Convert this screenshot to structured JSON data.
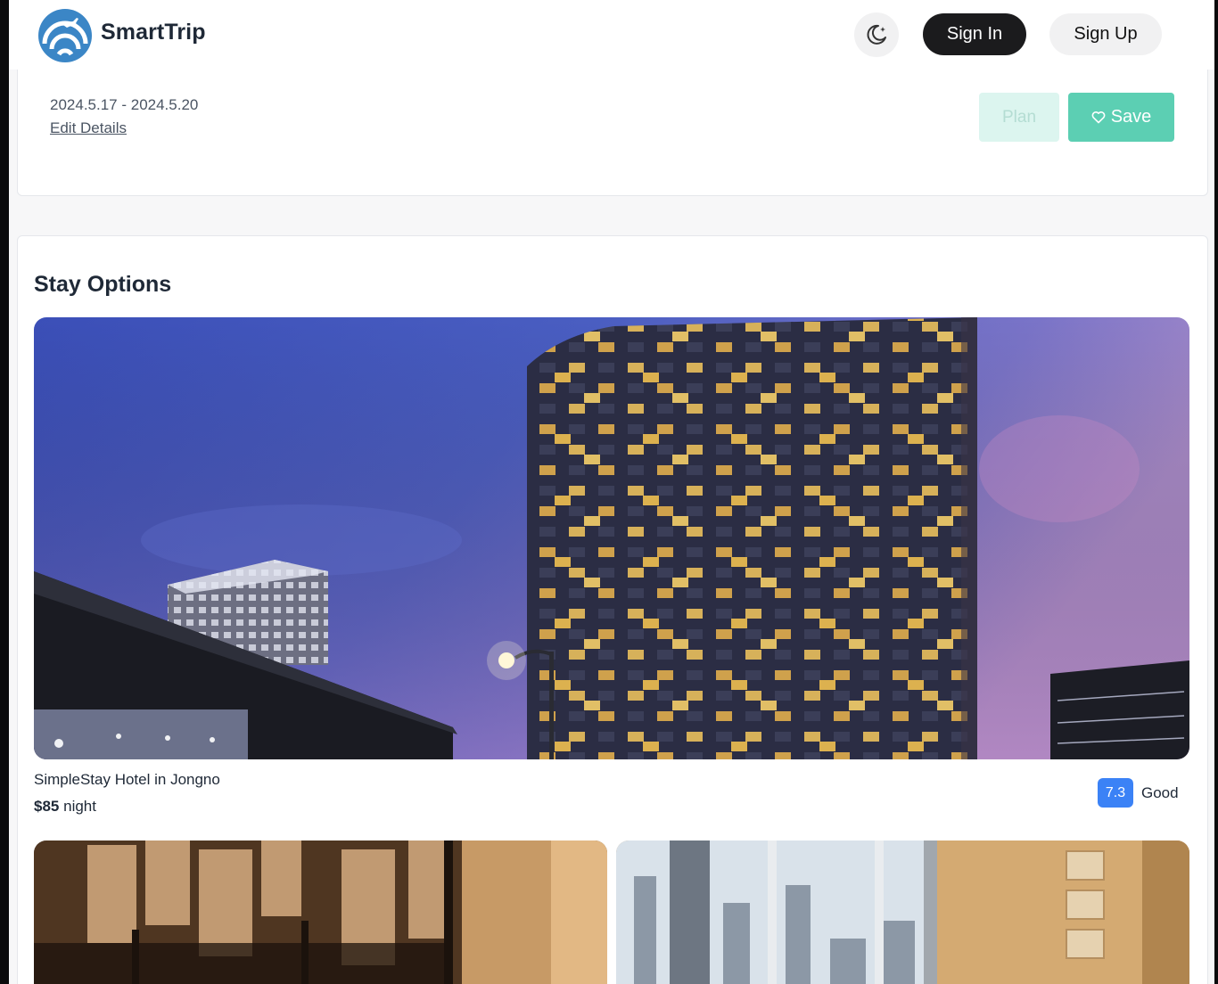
{
  "header": {
    "brand": "SmartTrip",
    "logo_icon": "plane-swirl-logo",
    "theme_icon": "moon-sparkle-icon",
    "sign_in_label": "Sign In",
    "sign_up_label": "Sign Up"
  },
  "trip": {
    "dates": "2024.5.17 - 2024.5.20",
    "edit_link": "Edit Details",
    "plan_label": "Plan",
    "save_label": "Save",
    "save_icon": "heart-icon"
  },
  "stay": {
    "title": "Stay Options",
    "hotels": [
      {
        "name": "SimpleStay Hotel in Jongno",
        "price": "$85",
        "price_unit": "night",
        "rating": "7.3",
        "rating_text": "Good"
      }
    ]
  },
  "colors": {
    "accent": "#5ccfb3",
    "accent_light": "#dcf5ef",
    "rating_badge": "#3b82f6",
    "primary_dark": "#1b1b1d"
  }
}
